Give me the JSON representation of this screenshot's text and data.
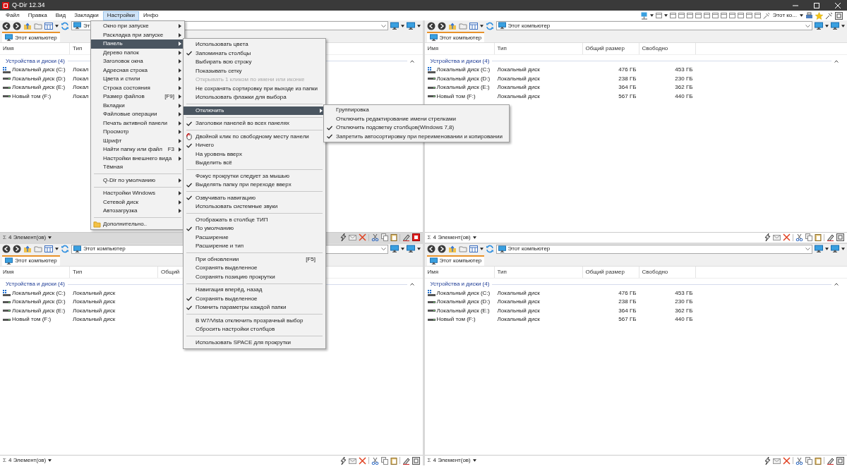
{
  "window": {
    "title": "Q-Dir 12.34"
  },
  "menubar": {
    "items": [
      {
        "label": "Файл",
        "selected": false
      },
      {
        "label": "Правка",
        "selected": false
      },
      {
        "label": "Вид",
        "selected": false
      },
      {
        "label": "Закладки",
        "selected": false
      },
      {
        "label": "Настройки",
        "selected": true
      },
      {
        "label": "Инфо",
        "selected": false
      }
    ],
    "right_label": "Этот ко..."
  },
  "menu": {
    "items": [
      {
        "kind": "item",
        "label": "Окно при запуске",
        "submenu": true,
        "selected": false
      },
      {
        "kind": "item",
        "label": "Раскладка при запуске",
        "submenu": true,
        "selected": false
      },
      {
        "kind": "item",
        "label": "Панель",
        "submenu": true,
        "selected": true
      },
      {
        "kind": "item",
        "label": "Дерево папок",
        "submenu": true,
        "selected": false
      },
      {
        "kind": "item",
        "label": "Заголовок окна",
        "submenu": true,
        "selected": false
      },
      {
        "kind": "item",
        "label": "Адресная строка",
        "submenu": true,
        "selected": false
      },
      {
        "kind": "item",
        "label": "Цвета и стили",
        "submenu": true,
        "selected": false
      },
      {
        "kind": "item",
        "label": "Строка состояния",
        "submenu": true,
        "selected": false
      },
      {
        "kind": "item",
        "label": "Размер файлов",
        "shortcut": "[F9]",
        "submenu": true,
        "selected": false
      },
      {
        "kind": "item",
        "label": "Вкладки",
        "submenu": true,
        "selected": false
      },
      {
        "kind": "item",
        "label": "Файловые операции",
        "submenu": true,
        "selected": false
      },
      {
        "kind": "item",
        "label": "Печать активной панели",
        "submenu": true,
        "selected": false
      },
      {
        "kind": "item",
        "label": "Просмотр",
        "submenu": true,
        "selected": false
      },
      {
        "kind": "item",
        "label": "Шрифт",
        "submenu": true,
        "selected": false
      },
      {
        "kind": "item",
        "label": "Найти папку или файл",
        "shortcut": "F3",
        "submenu": true,
        "selected": false
      },
      {
        "kind": "item",
        "label": "Настройки внешнего вида",
        "submenu": true,
        "selected": false
      },
      {
        "kind": "item",
        "label": "Тёмная",
        "submenu": false,
        "selected": false
      },
      {
        "kind": "separator"
      },
      {
        "kind": "item",
        "label": "Q-Dir по умолчанию",
        "submenu": true,
        "selected": false
      },
      {
        "kind": "separator"
      },
      {
        "kind": "item",
        "label": "Настройки Windows",
        "submenu": true,
        "selected": false
      },
      {
        "kind": "item",
        "label": "Сетевой диск",
        "submenu": true,
        "selected": false
      },
      {
        "kind": "item",
        "label": "Автозагрузка",
        "submenu": true,
        "selected": false
      },
      {
        "kind": "separator"
      },
      {
        "kind": "folder",
        "label": "Дополнительно..",
        "submenu": false,
        "selected": false
      }
    ]
  },
  "submenu": {
    "items": [
      {
        "kind": "item",
        "label": "Использовать цвета",
        "checked": false,
        "disabled": false,
        "selected": false,
        "submenu": false
      },
      {
        "kind": "item",
        "label": "Запоминать столбцы",
        "checked": true,
        "disabled": false,
        "selected": false,
        "submenu": false
      },
      {
        "kind": "item",
        "label": "Выбирать всю строку",
        "checked": false,
        "disabled": false,
        "selected": false,
        "submenu": false
      },
      {
        "kind": "item",
        "label": "Показывать сетку",
        "checked": false,
        "disabled": false,
        "selected": false,
        "submenu": false
      },
      {
        "kind": "item",
        "label": "Открывать 1 кликом по имени или иконке",
        "checked": false,
        "disabled": true,
        "selected": false,
        "submenu": false
      },
      {
        "kind": "item",
        "label": "Не сохранять сортировку при выходе из папки",
        "checked": false,
        "disabled": false,
        "selected": false,
        "submenu": false
      },
      {
        "kind": "item",
        "label": "Использовать флажки для выбора",
        "checked": false,
        "disabled": false,
        "selected": false,
        "submenu": false
      },
      {
        "kind": "separator"
      },
      {
        "kind": "item",
        "label": "Отключить",
        "checked": false,
        "disabled": false,
        "selected": true,
        "submenu": true
      },
      {
        "kind": "separator"
      },
      {
        "kind": "item",
        "label": "Заголовки панелей во всех панелях",
        "checked": true,
        "disabled": false,
        "selected": false,
        "submenu": false
      },
      {
        "kind": "separator"
      },
      {
        "kind": "mouse",
        "label": "Двойной клик по свободному месту панели",
        "checked": false,
        "disabled": false,
        "selected": false,
        "submenu": false
      },
      {
        "kind": "item",
        "label": "Ничего",
        "checked": true,
        "disabled": false,
        "selected": false,
        "submenu": false
      },
      {
        "kind": "item",
        "label": "На уровень вверх",
        "checked": false,
        "disabled": false,
        "selected": false,
        "submenu": false
      },
      {
        "kind": "item",
        "label": "Выделить всё",
        "checked": false,
        "disabled": false,
        "selected": false,
        "submenu": false
      },
      {
        "kind": "separator"
      },
      {
        "kind": "item",
        "label": "Фокус прокрутки следует за мышью",
        "checked": false,
        "disabled": false,
        "selected": false,
        "submenu": false
      },
      {
        "kind": "item",
        "label": "Выделять папку при переходе вверх",
        "checked": true,
        "disabled": false,
        "selected": false,
        "submenu": false
      },
      {
        "kind": "separator"
      },
      {
        "kind": "item",
        "label": "Озвучивать навигацию",
        "checked": true,
        "disabled": false,
        "selected": false,
        "submenu": false
      },
      {
        "kind": "item",
        "label": "Использовать системные звуки",
        "checked": false,
        "disabled": false,
        "selected": false,
        "submenu": false
      },
      {
        "kind": "separator"
      },
      {
        "kind": "item",
        "label": "Отображать в столбце ТИП",
        "checked": false,
        "disabled": false,
        "selected": false,
        "submenu": false
      },
      {
        "kind": "item",
        "label": "По умолчанию",
        "checked": true,
        "disabled": false,
        "selected": false,
        "submenu": false
      },
      {
        "kind": "item",
        "label": "Расширение",
        "checked": false,
        "disabled": false,
        "selected": false,
        "submenu": false
      },
      {
        "kind": "item",
        "label": "Расширение и тип",
        "checked": false,
        "disabled": false,
        "selected": false,
        "submenu": false
      },
      {
        "kind": "separator"
      },
      {
        "kind": "item",
        "label": "При обновлении",
        "shortcut": "[F5]",
        "checked": false,
        "disabled": false,
        "selected": false,
        "submenu": false
      },
      {
        "kind": "item",
        "label": "Сохранять выделенное",
        "checked": false,
        "disabled": false,
        "selected": false,
        "submenu": false
      },
      {
        "kind": "item",
        "label": "Сохранять позицию прокрутки",
        "checked": false,
        "disabled": false,
        "selected": false,
        "submenu": false
      },
      {
        "kind": "separator"
      },
      {
        "kind": "item",
        "label": "Навигация вперёд, назад",
        "checked": false,
        "disabled": false,
        "selected": false,
        "submenu": false
      },
      {
        "kind": "item",
        "label": "Сохранять выделенное",
        "checked": true,
        "disabled": false,
        "selected": false,
        "submenu": false
      },
      {
        "kind": "item",
        "label": "Помнить параметры каждой папки",
        "checked": true,
        "disabled": false,
        "selected": false,
        "submenu": false
      },
      {
        "kind": "separator"
      },
      {
        "kind": "item",
        "label": "В W7/Vista отключить прозрачный выбор",
        "checked": false,
        "disabled": false,
        "selected": false,
        "submenu": false
      },
      {
        "kind": "item",
        "label": "Сбросить настройки столбцов",
        "checked": false,
        "disabled": false,
        "selected": false,
        "submenu": false
      },
      {
        "kind": "separator"
      },
      {
        "kind": "item",
        "label": "Использовать SPACE для прокрутки",
        "checked": false,
        "disabled": false,
        "selected": false,
        "submenu": false
      }
    ]
  },
  "submenu_2": {
    "items": [
      {
        "label": "Группировка",
        "checked": false
      },
      {
        "label": "Отключить редактирование имени стрелками",
        "checked": false
      },
      {
        "label": "Отключить подсветку столбцов(Windows 7,8)",
        "checked": true
      },
      {
        "label": "Запретить автосортировку при переименовании и копировании",
        "checked": true
      }
    ]
  },
  "panes": [
    {
      "active": true,
      "address": "Эт",
      "tab": "Этот компьютер",
      "columns": [
        "Имя",
        "Тип"
      ],
      "group": "Устройства и диски (4)",
      "group_expanded": true,
      "rows": [
        {
          "kind": "system",
          "cells": [
            "Локальный диск (C:)",
            "Локал"
          ]
        },
        {
          "kind": "drive",
          "cells": [
            "Локальный диск (D:)",
            "Локал"
          ]
        },
        {
          "kind": "drive",
          "cells": [
            "Локальный диск (E:)",
            "Локал"
          ]
        },
        {
          "kind": "drive",
          "cells": [
            "Новый том (F:)",
            "Локал"
          ]
        }
      ],
      "status_symbol": "Σ",
      "status": "4 Элемент(ов)"
    },
    {
      "active": false,
      "address": "Этот компьютер",
      "tab": "Этот компьютер",
      "columns": [
        "Имя",
        "Тип",
        "Общий размер",
        "Свободно"
      ],
      "group": "Устройства и диски (4)",
      "group_expanded": true,
      "rows": [
        {
          "kind": "system",
          "cells": [
            "Локальный диск (C:)",
            "Локальный диск",
            "476 ГБ",
            "453 ГБ"
          ]
        },
        {
          "kind": "drive",
          "cells": [
            "Локальный диск (D:)",
            "Локальный диск",
            "238 ГБ",
            "230 ГБ"
          ]
        },
        {
          "kind": "drive",
          "cells": [
            "Локальный диск (E:)",
            "Локальный диск",
            "364 ГБ",
            "362 ГБ"
          ]
        },
        {
          "kind": "drive",
          "cells": [
            "Новый том (F:)",
            "Локальный диск",
            "567 ГБ",
            "440 ГБ"
          ]
        }
      ],
      "status_symbol": "Σ",
      "status": "4 Элемент(ов)"
    },
    {
      "active": false,
      "address": "Этот компьютер",
      "tab": "Этот компьютер",
      "columns": [
        "Имя",
        "Тип",
        "Общий"
      ],
      "group": "Устройства и диски (4)",
      "group_expanded": true,
      "rows": [
        {
          "kind": "system",
          "cells": [
            "Локальный диск (C:)",
            "Локальный диск"
          ]
        },
        {
          "kind": "drive",
          "cells": [
            "Локальный диск (D:)",
            "Локальный диск"
          ]
        },
        {
          "kind": "drive",
          "cells": [
            "Локальный диск (E:)",
            "Локальный диск"
          ]
        },
        {
          "kind": "drive",
          "cells": [
            "Новый том (F:)",
            "Локальный диск"
          ]
        }
      ],
      "status_symbol": "Σ",
      "status": "4 Элемент(ов)"
    },
    {
      "active": false,
      "address": "Этот компьютер",
      "tab": "Этот компьютер",
      "columns": [
        "Имя",
        "Тип",
        "Общий размер",
        "Свободно"
      ],
      "group": "Устройства и диски (4)",
      "group_expanded": true,
      "rows": [
        {
          "kind": "system",
          "cells": [
            "Локальный диск (C:)",
            "Локальный диск",
            "476 ГБ",
            "453 ГБ"
          ]
        },
        {
          "kind": "drive",
          "cells": [
            "Локальный диск (D:)",
            "Локальный диск",
            "238 ГБ",
            "230 ГБ"
          ]
        },
        {
          "kind": "drive",
          "cells": [
            "Локальный диск (E:)",
            "Локальный диск",
            "364 ГБ",
            "362 ГБ"
          ]
        },
        {
          "kind": "drive",
          "cells": [
            "Новый том (F:)",
            "Локальный диск",
            "567 ГБ",
            "440 ГБ"
          ]
        }
      ],
      "status_symbol": "Σ",
      "status": "4 Элемент(ов)"
    }
  ]
}
